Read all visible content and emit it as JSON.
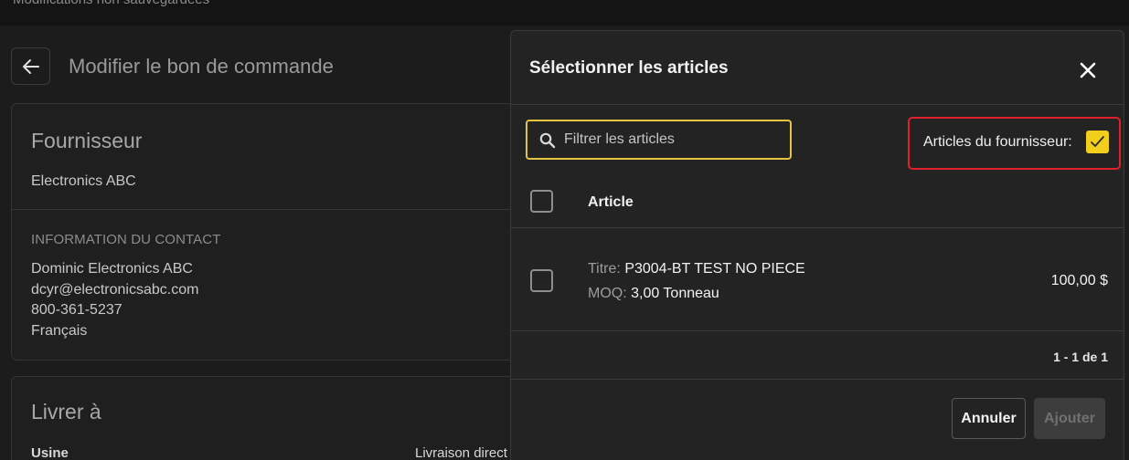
{
  "banner": {
    "text": "Modifications non sauvegardées"
  },
  "header": {
    "title": "Modifier le bon de commande"
  },
  "supplier_card": {
    "title": "Fournisseur",
    "name": "Electronics ABC",
    "contact_label": "INFORMATION DU CONTACT",
    "contact_lines": [
      "Dominic Electronics ABC",
      "dcyr@electronicsabc.com",
      "800-361-5237",
      "Français"
    ]
  },
  "delivery_card": {
    "title": "Livrer à",
    "usine_label": "Usine",
    "direct_label": "Livraison direct"
  },
  "modal": {
    "title": "Sélectionner les articles",
    "search": {
      "placeholder": "Filtrer les articles",
      "value": ""
    },
    "supplier_filter": {
      "label": "Articles du fournisseur:",
      "checked": true
    },
    "column_header": "Article",
    "rows": [
      {
        "title_label": "Titre:",
        "title_value": "P3004-BT TEST NO PIECE",
        "moq_label": "MOQ:",
        "moq_value": "3,00 Tonneau",
        "price": "100,00 $"
      }
    ],
    "pagination": "1 - 1 de 1",
    "cancel_label": "Annuler",
    "add_label": "Ajouter"
  },
  "colors": {
    "background": "#1c1c1c",
    "modal_bg": "#232323",
    "accent_yellow": "#f2cf1c",
    "highlight_red": "#e0202a",
    "search_border": "#e5c342"
  },
  "icons": [
    "arrow-left-icon",
    "close-icon",
    "search-icon",
    "checkmark-icon"
  ]
}
